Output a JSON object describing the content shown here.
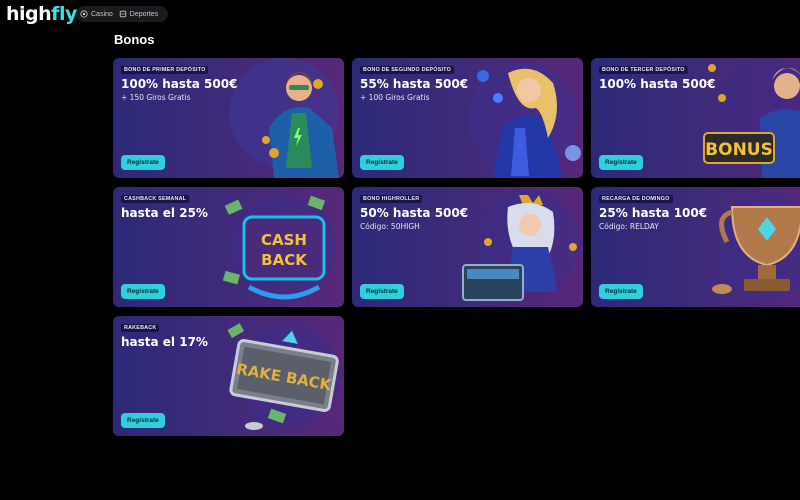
{
  "brand": {
    "logo_part1": "high",
    "logo_part2": "fly"
  },
  "nav": [
    {
      "label": "Casino",
      "icon": "casino-icon"
    },
    {
      "label": "Deportes",
      "icon": "sports-icon"
    }
  ],
  "page": {
    "title": "Bonos"
  },
  "colors": {
    "accent": "#34e3e3",
    "button": "#2fd0dc",
    "card_bg_start": "#2c2a78",
    "card_bg_end": "#58287a"
  },
  "bonuses": [
    {
      "tag": "Bono de primer depósito",
      "headline": "100% hasta 500€",
      "sub": "+ 150 Giros Gratis",
      "button": "Regístrate",
      "art": "superhero-art"
    },
    {
      "tag": "Bono de segundo depósito",
      "headline": "55% hasta 500€",
      "sub": "+ 100 Giros Gratis",
      "button": "Regístrate",
      "art": "heroine-art"
    },
    {
      "tag": "Bono de tercer depósito",
      "headline": "100% hasta 500€",
      "sub": "",
      "button": "Regístrate",
      "art": "bonus-hero-art"
    },
    {
      "tag": "Cashback semanal",
      "headline": "hasta el 25%",
      "sub": "",
      "button": "Regístrate",
      "art": "cashback-sign-art"
    },
    {
      "tag": "Bono Highroller",
      "headline": "50% hasta 500€",
      "sub": "Código: 50HIGH",
      "button": "Regístrate",
      "art": "treasure-queen-art"
    },
    {
      "tag": "Recarga de domingo",
      "headline": "25% hasta 100€",
      "sub": "Código: RELDAY",
      "button": "Regístrate",
      "art": "trophy-art"
    },
    {
      "tag": "Rakeback",
      "headline": "hasta el 17%",
      "sub": "",
      "button": "Regístrate",
      "art": "rakeback-sign-art"
    }
  ]
}
